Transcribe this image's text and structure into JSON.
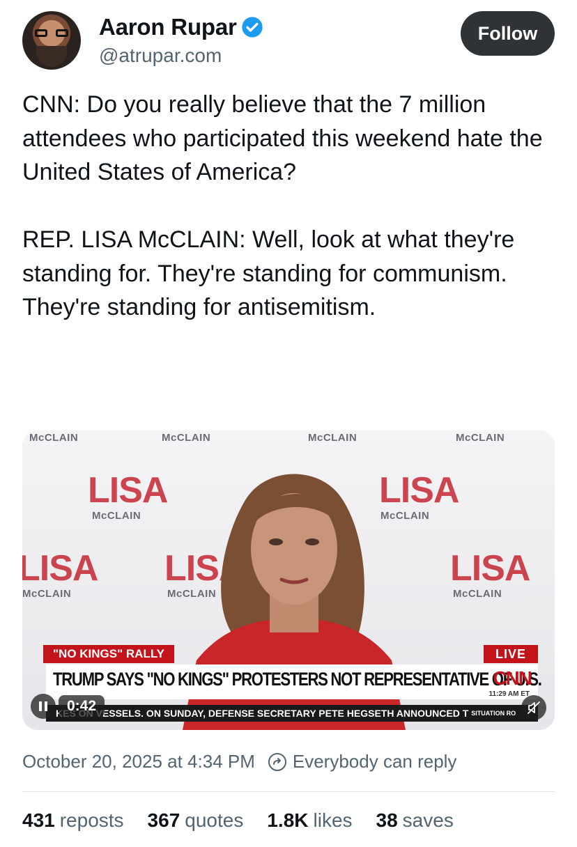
{
  "author": {
    "display_name": "Aaron Rupar",
    "handle": "@atrupar.com",
    "verified": true,
    "avatar_icon": "avatar-photo"
  },
  "follow_label": "Follow",
  "post": {
    "paragraph_1": "CNN: Do you really believe that the 7 million attendees who participated this weekend hate the United States of America?",
    "paragraph_2": "REP. LISA McCLAIN: Well, look at what they're standing for. They're standing for communism. They're standing for antisemitism."
  },
  "video": {
    "backdrop_name": "LISA",
    "backdrop_sub": "McCLAIN",
    "chyron_tag": "\"NO KINGS\" RALLY",
    "live_label": "LIVE",
    "headline": "TRUMP SAYS \"NO KINGS\" PROTESTERS NOT REPRESENTATIVE OF U.S.",
    "network": "CNN",
    "time": "11:29 AM ET",
    "ticker": "KES ON VESSELS. ON SUNDAY, DEFENSE SECRETARY PETE HEGSETH ANNOUNCED T",
    "ticker_tag": "SITUATION RO",
    "duration": "0:42",
    "muted": true
  },
  "meta": {
    "timestamp": "October 20, 2025 at 4:34 PM",
    "reply_setting": "Everybody can reply"
  },
  "stats": {
    "reposts_count": "431",
    "reposts_label": "reposts",
    "quotes_count": "367",
    "quotes_label": "quotes",
    "likes_count": "1.8K",
    "likes_label": "likes",
    "saves_count": "38",
    "saves_label": "saves"
  },
  "colors": {
    "text": "#0f1419",
    "secondary": "#536471",
    "verified": "#1d9bf0",
    "follow_bg": "#2f3336",
    "cnn_red": "#c4141b"
  }
}
